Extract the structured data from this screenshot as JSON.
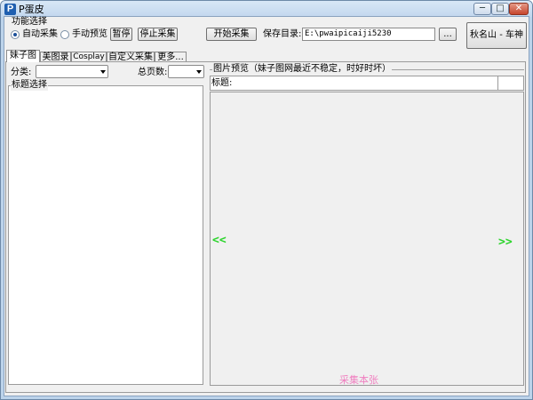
{
  "window": {
    "title": "P蛋皮",
    "icon_letter": "P",
    "controls": {
      "minimize": "─",
      "maximize": "□",
      "close": "✕"
    }
  },
  "function_group": {
    "title": "功能选择",
    "options": [
      {
        "label": "自动采集",
        "checked": true
      },
      {
        "label": "手动预览",
        "checked": false
      }
    ],
    "pause_label": "暂停",
    "stop_label": "停止采集"
  },
  "toolbar": {
    "start_label": "开始采集",
    "save_dir_label": "保存目录:",
    "save_dir_value": "E:\\pwaipicaiji5230",
    "browse_label": "...",
    "signature_label": "秋名山 - 车神"
  },
  "tabs": [
    "妹子图",
    "美图录",
    "Cosplay",
    "自定义采集",
    "更多..."
  ],
  "left_panel": {
    "category_label": "分类:",
    "category_value": "",
    "total_pages_label": "总页数:",
    "total_pages_value": "",
    "title_select_label": "标题选择"
  },
  "preview": {
    "title": "图片预览（妹子图网最近不稳定，时好时坏）",
    "caption_label": "标题:",
    "caption_value": "",
    "prev_label": "<<",
    "next_label": ">>",
    "collect_this_label": "采集本张"
  },
  "colors": {
    "accent_green": "#2bd42b",
    "collect_pink": "#f080c0",
    "window_frame": "#bcd3eb"
  }
}
